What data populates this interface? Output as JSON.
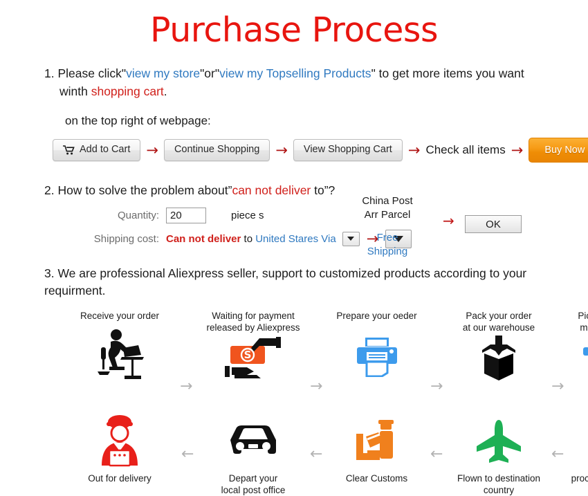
{
  "title": "Purchase Process",
  "colors": {
    "title_red": "#e8150f",
    "link_blue": "#2f79c0",
    "accent_red": "#d0201b",
    "buy_now_orange": "#f79c18",
    "gray_arrow": "#b2b2b2"
  },
  "step1": {
    "number": "1.",
    "t1": "Please click\"",
    "link1": "view my store",
    "t2": "\"or\"",
    "link2": "view my Topselling Products",
    "t3": "\" to get more items you want",
    "t4": "winth ",
    "highlight": "shopping cart",
    "t5": ".",
    "note": "on the top right of webpage:",
    "buttons": {
      "add_to_cart": "Add to Cart",
      "continue_shopping": "Continue Shopping",
      "view_shopping_cart": "View Shopping Cart",
      "check_all_items": "Check all items",
      "buy_now": "Buy Now"
    },
    "arrow": "→"
  },
  "step2": {
    "number": "2.",
    "t1": "How to solve the problem about”",
    "highlight": "can not deliver",
    "t2": " to”?",
    "quantity_label": "Quantity:",
    "quantity_value": "20",
    "piece_label": "piece s",
    "shipping_label": "Shipping cost:",
    "shipping_cannot": "Can not deliver",
    "shipping_to": " to ",
    "shipping_country": "United Stares Via",
    "carrier_line1": "China Post",
    "carrier_line2": "Arr Parcel",
    "free_shipping": "Free\nShipping",
    "ok_button": "OK",
    "arrow": "→"
  },
  "step3": {
    "number": "3.",
    "text": "We are professional Aliexpress seller, support to customized products according to your requirment."
  },
  "flow": {
    "row1": [
      {
        "label": "Receive your order",
        "icon": "person-at-desk-icon"
      },
      {
        "label": "Waiting for payment\nreleased by Aliexpress",
        "icon": "money-handoff-icon"
      },
      {
        "label": "Prepare your oeder",
        "icon": "printer-icon"
      },
      {
        "label": "Pack your order\nat our warehouse",
        "icon": "package-box-icon"
      },
      {
        "label": "Picked up by\nmail service",
        "icon": "truck-icon"
      }
    ],
    "row2": [
      {
        "label": "Out for delivery",
        "icon": "delivery-person-icon"
      },
      {
        "label": "Depart your\nlocal post office",
        "icon": "car-icon"
      },
      {
        "label": "Clear Customs",
        "icon": "customs-officer-icon"
      },
      {
        "label": "Flown to destination\ncountry",
        "icon": "airplane-icon"
      },
      {
        "label": "processed through\nsort facility",
        "icon": "globe-plane-icon"
      }
    ],
    "arrow_right": "→",
    "arrow_left": "←",
    "arrow_down": "↓"
  }
}
